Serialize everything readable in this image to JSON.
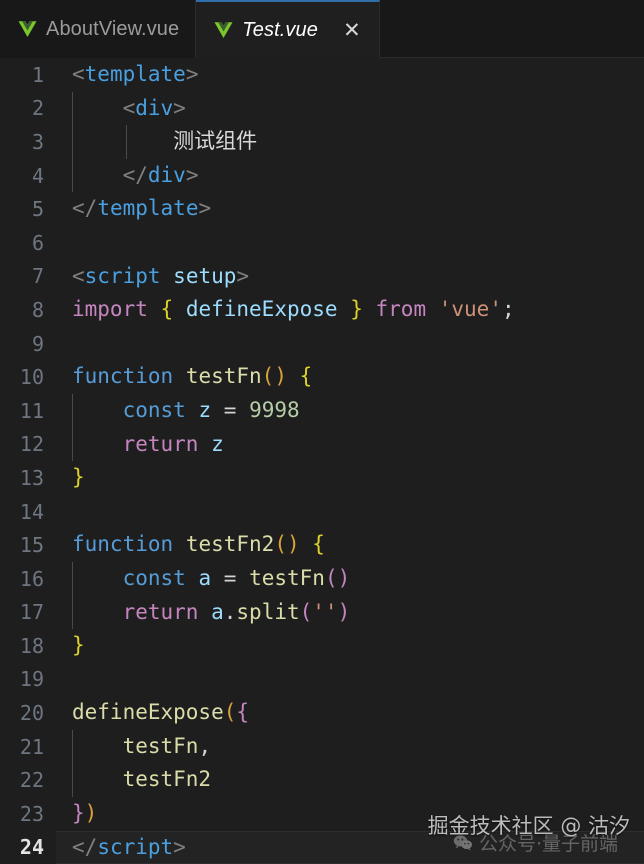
{
  "window": {
    "app": "code-editor",
    "background": "#1e1e1e"
  },
  "tabbar": {
    "tabs": [
      {
        "label": "AboutView.vue",
        "icon": "vue-logo-icon",
        "active": false,
        "closable": false
      },
      {
        "label": "Test.vue",
        "icon": "vue-logo-icon",
        "active": true,
        "closable": true,
        "close_label": "✕"
      }
    ],
    "active_border_color": "#2f6ea8",
    "active_bg": "#1f1f1f",
    "inactive_bg": "#181818"
  },
  "editor": {
    "language": "vue",
    "active_line": 24,
    "line_numbers": [
      1,
      2,
      3,
      4,
      5,
      6,
      7,
      8,
      9,
      10,
      11,
      12,
      13,
      14,
      15,
      16,
      17,
      18,
      19,
      20,
      21,
      22,
      23,
      24
    ],
    "lines": [
      {
        "n": 1,
        "indent": 0,
        "guides": [],
        "tokens": [
          {
            "t": "<",
            "c": "punc"
          },
          {
            "t": "template",
            "c": "tag"
          },
          {
            "t": ">",
            "c": "punc"
          }
        ]
      },
      {
        "n": 2,
        "indent": 1,
        "guides": [
          1
        ],
        "tokens": [
          {
            "t": "    ",
            "c": "plain"
          },
          {
            "t": "<",
            "c": "punc"
          },
          {
            "t": "div",
            "c": "tag"
          },
          {
            "t": ">",
            "c": "punc"
          }
        ]
      },
      {
        "n": 3,
        "indent": 2,
        "guides": [
          1,
          2
        ],
        "tokens": [
          {
            "t": "        ",
            "c": "plain"
          },
          {
            "t": "测试组件",
            "c": "cn"
          }
        ]
      },
      {
        "n": 4,
        "indent": 1,
        "guides": [
          1
        ],
        "tokens": [
          {
            "t": "    ",
            "c": "plain"
          },
          {
            "t": "<",
            "c": "punc"
          },
          {
            "t": "/",
            "c": "punc"
          },
          {
            "t": "div",
            "c": "tag"
          },
          {
            "t": ">",
            "c": "punc"
          }
        ]
      },
      {
        "n": 5,
        "indent": 0,
        "guides": [],
        "tokens": [
          {
            "t": "<",
            "c": "punc"
          },
          {
            "t": "/",
            "c": "punc"
          },
          {
            "t": "template",
            "c": "tag"
          },
          {
            "t": ">",
            "c": "punc"
          }
        ]
      },
      {
        "n": 6,
        "indent": 0,
        "guides": [],
        "tokens": []
      },
      {
        "n": 7,
        "indent": 0,
        "guides": [],
        "tokens": [
          {
            "t": "<",
            "c": "punc"
          },
          {
            "t": "script",
            "c": "tag"
          },
          {
            "t": " ",
            "c": "plain"
          },
          {
            "t": "setup",
            "c": "var"
          },
          {
            "t": ">",
            "c": "punc"
          }
        ]
      },
      {
        "n": 8,
        "indent": 0,
        "guides": [],
        "tokens": [
          {
            "t": "import",
            "c": "kw"
          },
          {
            "t": " ",
            "c": "plain"
          },
          {
            "t": "{",
            "c": "brace-y"
          },
          {
            "t": " ",
            "c": "plain"
          },
          {
            "t": "defineExpose",
            "c": "var"
          },
          {
            "t": " ",
            "c": "plain"
          },
          {
            "t": "}",
            "c": "brace-y"
          },
          {
            "t": " ",
            "c": "plain"
          },
          {
            "t": "from",
            "c": "kw"
          },
          {
            "t": " ",
            "c": "plain"
          },
          {
            "t": "'vue'",
            "c": "str"
          },
          {
            "t": ";",
            "c": "plain"
          }
        ]
      },
      {
        "n": 9,
        "indent": 0,
        "guides": [],
        "tokens": []
      },
      {
        "n": 10,
        "indent": 0,
        "guides": [],
        "tokens": [
          {
            "t": "function",
            "c": "kw2"
          },
          {
            "t": " ",
            "c": "plain"
          },
          {
            "t": "testFn",
            "c": "fn"
          },
          {
            "t": "()",
            "c": "brace-o"
          },
          {
            "t": " ",
            "c": "plain"
          },
          {
            "t": "{",
            "c": "brace-y"
          }
        ]
      },
      {
        "n": 11,
        "indent": 1,
        "guides": [
          1
        ],
        "tokens": [
          {
            "t": "    ",
            "c": "plain"
          },
          {
            "t": "const",
            "c": "kw2"
          },
          {
            "t": " ",
            "c": "plain"
          },
          {
            "t": "z",
            "c": "var"
          },
          {
            "t": " ",
            "c": "plain"
          },
          {
            "t": "=",
            "c": "op"
          },
          {
            "t": " ",
            "c": "plain"
          },
          {
            "t": "9998",
            "c": "num"
          }
        ]
      },
      {
        "n": 12,
        "indent": 1,
        "guides": [
          1
        ],
        "tokens": [
          {
            "t": "    ",
            "c": "plain"
          },
          {
            "t": "return",
            "c": "kw"
          },
          {
            "t": " ",
            "c": "plain"
          },
          {
            "t": "z",
            "c": "var"
          }
        ]
      },
      {
        "n": 13,
        "indent": 0,
        "guides": [],
        "tokens": [
          {
            "t": "}",
            "c": "brace-y"
          }
        ]
      },
      {
        "n": 14,
        "indent": 0,
        "guides": [],
        "tokens": []
      },
      {
        "n": 15,
        "indent": 0,
        "guides": [],
        "tokens": [
          {
            "t": "function",
            "c": "kw2"
          },
          {
            "t": " ",
            "c": "plain"
          },
          {
            "t": "testFn2",
            "c": "fn"
          },
          {
            "t": "()",
            "c": "brace-o"
          },
          {
            "t": " ",
            "c": "plain"
          },
          {
            "t": "{",
            "c": "brace-y"
          }
        ]
      },
      {
        "n": 16,
        "indent": 1,
        "guides": [
          1
        ],
        "tokens": [
          {
            "t": "    ",
            "c": "plain"
          },
          {
            "t": "const",
            "c": "kw2"
          },
          {
            "t": " ",
            "c": "plain"
          },
          {
            "t": "a",
            "c": "var"
          },
          {
            "t": " ",
            "c": "plain"
          },
          {
            "t": "=",
            "c": "op"
          },
          {
            "t": " ",
            "c": "plain"
          },
          {
            "t": "testFn",
            "c": "fn"
          },
          {
            "t": "()",
            "c": "brace-p"
          }
        ]
      },
      {
        "n": 17,
        "indent": 1,
        "guides": [
          1
        ],
        "tokens": [
          {
            "t": "    ",
            "c": "plain"
          },
          {
            "t": "return",
            "c": "kw"
          },
          {
            "t": " ",
            "c": "plain"
          },
          {
            "t": "a",
            "c": "var"
          },
          {
            "t": ".",
            "c": "plain"
          },
          {
            "t": "split",
            "c": "fn"
          },
          {
            "t": "(",
            "c": "brace-p"
          },
          {
            "t": "''",
            "c": "str"
          },
          {
            "t": ")",
            "c": "brace-p"
          }
        ]
      },
      {
        "n": 18,
        "indent": 0,
        "guides": [],
        "tokens": [
          {
            "t": "}",
            "c": "brace-y"
          }
        ]
      },
      {
        "n": 19,
        "indent": 0,
        "guides": [],
        "tokens": []
      },
      {
        "n": 20,
        "indent": 0,
        "guides": [],
        "tokens": [
          {
            "t": "defineExpose",
            "c": "fn"
          },
          {
            "t": "(",
            "c": "brace-o"
          },
          {
            "t": "{",
            "c": "brace-p"
          }
        ]
      },
      {
        "n": 21,
        "indent": 1,
        "guides": [
          1
        ],
        "tokens": [
          {
            "t": "    ",
            "c": "plain"
          },
          {
            "t": "testFn",
            "c": "fn"
          },
          {
            "t": ",",
            "c": "plain"
          }
        ]
      },
      {
        "n": 22,
        "indent": 1,
        "guides": [
          1
        ],
        "tokens": [
          {
            "t": "    ",
            "c": "plain"
          },
          {
            "t": "testFn2",
            "c": "fn"
          }
        ]
      },
      {
        "n": 23,
        "indent": 0,
        "guides": [],
        "tokens": [
          {
            "t": "}",
            "c": "brace-p"
          },
          {
            "t": ")",
            "c": "brace-o"
          }
        ]
      },
      {
        "n": 24,
        "indent": 0,
        "guides": [],
        "tokens": [
          {
            "t": "<",
            "c": "punc"
          },
          {
            "t": "/",
            "c": "punc"
          },
          {
            "t": "script",
            "c": "tag"
          },
          {
            "t": ">",
            "c": "punc"
          }
        ]
      }
    ]
  },
  "watermarks": {
    "primary": "掘金技术社区 @ 沽汐",
    "secondary": "公众号·量子前端",
    "secondary_icon": "wechat-icon"
  }
}
